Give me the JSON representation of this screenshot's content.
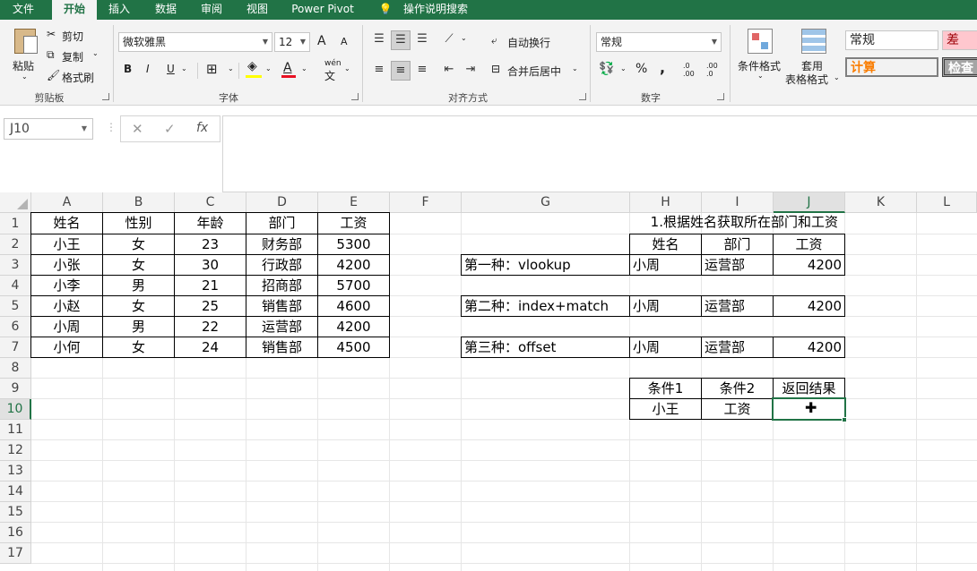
{
  "tabs": [
    "文件",
    "开始",
    "插入",
    "数据",
    "审阅",
    "视图",
    "Power Pivot",
    "操作说明搜索"
  ],
  "clipboard": {
    "paste": "粘贴",
    "cut": "剪切",
    "copy": "复制",
    "format_painter": "格式刷",
    "label": "剪贴板"
  },
  "font": {
    "name": "微软雅黑",
    "size": "12",
    "bold": "B",
    "italic": "I",
    "underline": "U",
    "grow": "A",
    "shrink": "A",
    "phonetic": "wén",
    "label": "字体",
    "font_color": "#e81123",
    "fill_color": "#ffff00"
  },
  "align": {
    "wrap": "自动换行",
    "merge": "合并后居中",
    "label": "对齐方式"
  },
  "number": {
    "format": "常规",
    "percent": "%",
    "comma": ",",
    "inc": ".0 .00",
    "dec": ".00 .0",
    "label": "数字"
  },
  "styles": {
    "cond": "条件格式",
    "table_line1": "套用",
    "table_line2": "表格格式",
    "normal": "常规",
    "bad": "差",
    "calc": "计算",
    "check": "检查"
  },
  "formula_bar": {
    "name_box": "J10",
    "cancel": "✕",
    "enter": "✓",
    "fx": "fx",
    "formula": ""
  },
  "columns": [
    "A",
    "B",
    "C",
    "D",
    "E",
    "F",
    "G",
    "H",
    "I",
    "J",
    "K",
    "L"
  ],
  "rows": [
    "1",
    "2",
    "3",
    "4",
    "5",
    "6",
    "7",
    "8",
    "9",
    "10",
    "11",
    "12",
    "13",
    "14",
    "15",
    "16",
    "17"
  ],
  "table1": {
    "header": [
      "姓名",
      "性别",
      "年龄",
      "部门",
      "工资"
    ],
    "rows": [
      [
        "小王",
        "女",
        "23",
        "财务部",
        "5300"
      ],
      [
        "小张",
        "女",
        "30",
        "行政部",
        "4200"
      ],
      [
        "小李",
        "男",
        "21",
        "招商部",
        "5700"
      ],
      [
        "小赵",
        "女",
        "25",
        "销售部",
        "4600"
      ],
      [
        "小周",
        "男",
        "22",
        "运营部",
        "4200"
      ],
      [
        "小何",
        "女",
        "24",
        "销售部",
        "4500"
      ]
    ]
  },
  "section_title": "1.根据姓名获取所在部门和工资",
  "lookup_header": [
    "姓名",
    "部门",
    "工资"
  ],
  "lookups": [
    {
      "label": "第一种：vlookup",
      "name": "小周",
      "dept": "运营部",
      "salary": "4200"
    },
    {
      "label": "第二种：index+match",
      "name": "小周",
      "dept": "运营部",
      "salary": "4200"
    },
    {
      "label": "第三种：offset",
      "name": "小周",
      "dept": "运营部",
      "salary": "4200"
    }
  ],
  "cond_table": {
    "header": [
      "条件1",
      "条件2",
      "返回结果"
    ],
    "row": [
      "小王",
      "工资",
      ""
    ]
  },
  "colors": {
    "excel_green": "#217346",
    "bad_fill": "#ffc7ce",
    "bad_text": "#9c0006",
    "calc_text": "#fa7d00"
  }
}
